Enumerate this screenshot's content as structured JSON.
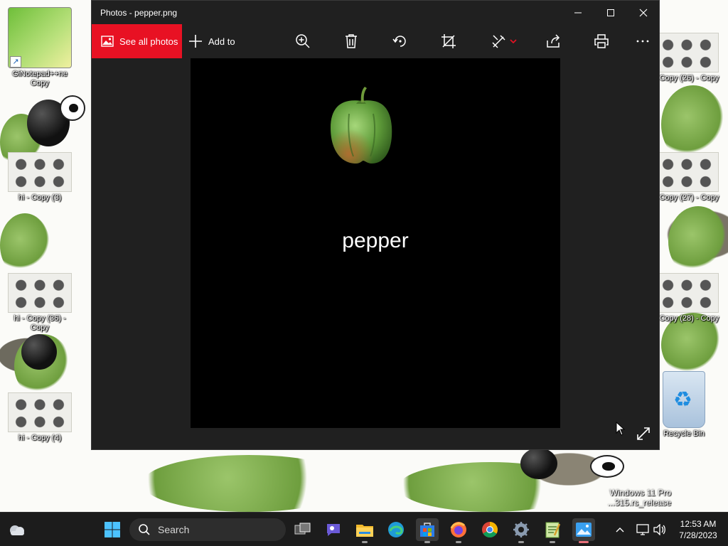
{
  "window": {
    "title": "Photos - pepper.png",
    "minimize_icon": "minimize-icon",
    "maximize_icon": "maximize-icon",
    "close_icon": "close-icon"
  },
  "toolbar": {
    "see_all_label": "See all photos",
    "add_to_label": "Add to",
    "buttons": [
      "zoom-in-icon",
      "delete-icon",
      "rotate-icon",
      "crop-icon",
      "edit-icon",
      "share-icon",
      "print-icon",
      "more-icon"
    ]
  },
  "image": {
    "caption": "pepper",
    "subject": "green-bell-pepper"
  },
  "desktop": {
    "icons": [
      {
        "label": "GiNotepad++ne Copy"
      },
      {
        "label": "hi - Copy (3)"
      },
      {
        "label": "hi - Copy (36) - Copy"
      },
      {
        "label": "hi - Copy (4)"
      },
      {
        "label": "- Copy (26) - Copy"
      },
      {
        "label": "- Copy (27) - Copy"
      },
      {
        "label": "- Copy (28) - Copy"
      },
      {
        "label": "Recycle Bin"
      }
    ],
    "watermark_line1": "Windows 11 Pro",
    "watermark_line2": "...315.rs_release"
  },
  "taskbar": {
    "search_label": "Search",
    "time": "12:53 AM",
    "date": "7/28/2023",
    "apps": [
      "task-view-icon",
      "teams-chat-icon",
      "file-explorer-icon",
      "edge-icon",
      "store-icon",
      "firefox-icon",
      "chrome-icon",
      "settings-icon",
      "notepad-icon",
      "photos-icon"
    ]
  },
  "colors": {
    "accent_red": "#e81123",
    "window_bg": "#202020",
    "taskbar_bg": "#1c1c1c"
  }
}
